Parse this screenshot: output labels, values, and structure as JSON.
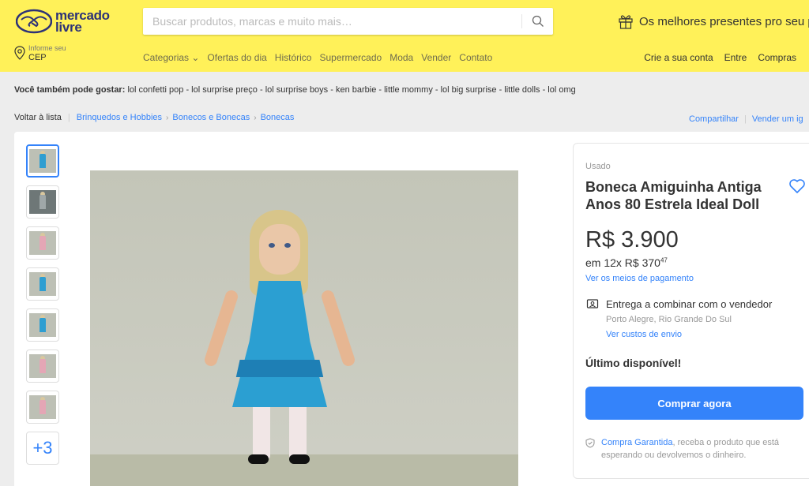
{
  "header": {
    "logo_line1": "mercado",
    "logo_line2": "livre",
    "search_placeholder": "Buscar produtos, marcas e muito mais…",
    "promo": "Os melhores presentes pro seu p",
    "cep_small": "Informe seu",
    "cep_big": "CEP",
    "nav": [
      "Categorias ⌄",
      "Ofertas do dia",
      "Histórico",
      "Supermercado",
      "Moda",
      "Vender",
      "Contato"
    ],
    "user_nav": [
      "Crie a sua conta",
      "Entre",
      "Compras"
    ],
    "bg_color": "#fff159"
  },
  "related": {
    "label": "Você também pode gostar:",
    "items": "lol confetti pop - lol surprise preço - lol surprise boys - ken barbie - little mommy - lol big surprise - little dolls - lol omg"
  },
  "breadcrumb": {
    "back": "Voltar à lista",
    "items": [
      "Brinquedos e Hobbies",
      "Bonecos e Bonecas",
      "Bonecas"
    ],
    "share": "Compartilhar",
    "sell": "Vender um ig"
  },
  "gallery": {
    "more_label": "+3"
  },
  "product": {
    "condition": "Usado",
    "title": "Boneca Amiguinha Antiga Anos 80 Estrela Ideal Doll",
    "price": "R$ 3.900",
    "installments_prefix": "em 12x R$ 370",
    "installments_cents": "47",
    "payment_link": "Ver os meios de pagamento",
    "shipping_title": "Entrega a combinar com o vendedor",
    "shipping_location": "Porto Alegre, Rio Grande Do Sul",
    "shipping_link": "Ver custos de envio",
    "stock": "Último disponível!",
    "buy_button": "Comprar agora",
    "guarantee_link": "Compra Garantida",
    "guarantee_text": ", receba o produto que está esperando ou devolvemos o dinheiro.",
    "accent_color": "#3483fa"
  }
}
